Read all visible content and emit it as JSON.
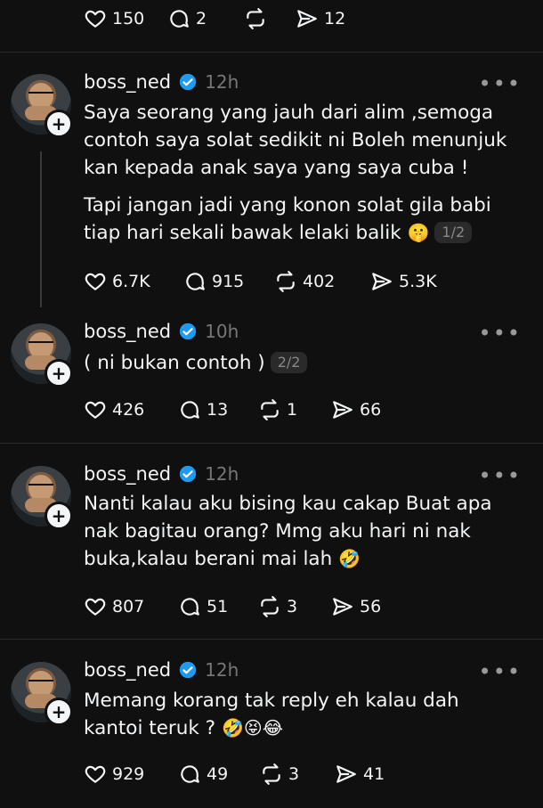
{
  "top_stats": {
    "likes": "150",
    "replies": "2",
    "reposts": "",
    "shares": "12"
  },
  "posts": [
    {
      "username": "boss_ned",
      "time": "12h",
      "text1": "Saya seorang yang jauh dari alim ,semoga\ncontoh saya solat sedikit ni Boleh menunjuk\nkan kepada anak saya yang saya cuba !",
      "text2": "Tapi jangan jadi yang konon solat gila babi\ntiap hari sekali bawak lelaki balik",
      "emoji": "🤫",
      "pager": "1/2",
      "likes": "6.7K",
      "replies": "915",
      "reposts": "402",
      "shares": "5.3K"
    },
    {
      "username": "boss_ned",
      "time": "10h",
      "text1": "( ni bukan contoh )",
      "pager": "2/2",
      "likes": "426",
      "replies": "13",
      "reposts": "1",
      "shares": "66"
    },
    {
      "username": "boss_ned",
      "time": "12h",
      "text1": "Nanti kalau aku bising kau cakap Buat apa\nnak bagitau orang? Mmg aku hari ni nak\nbuka,kalau berani mai lah",
      "emoji": "🤣",
      "likes": "807",
      "replies": "51",
      "reposts": "3",
      "shares": "56"
    },
    {
      "username": "boss_ned",
      "time": "12h",
      "text1": "Memang korang tak reply eh kalau dah\nkantoi teruk ?",
      "emoji": "🤣😝😂",
      "likes": "929",
      "replies": "49",
      "reposts": "3",
      "shares": "41"
    }
  ],
  "icons": {
    "verified_color": "#1d9bf0",
    "more": "•••"
  }
}
